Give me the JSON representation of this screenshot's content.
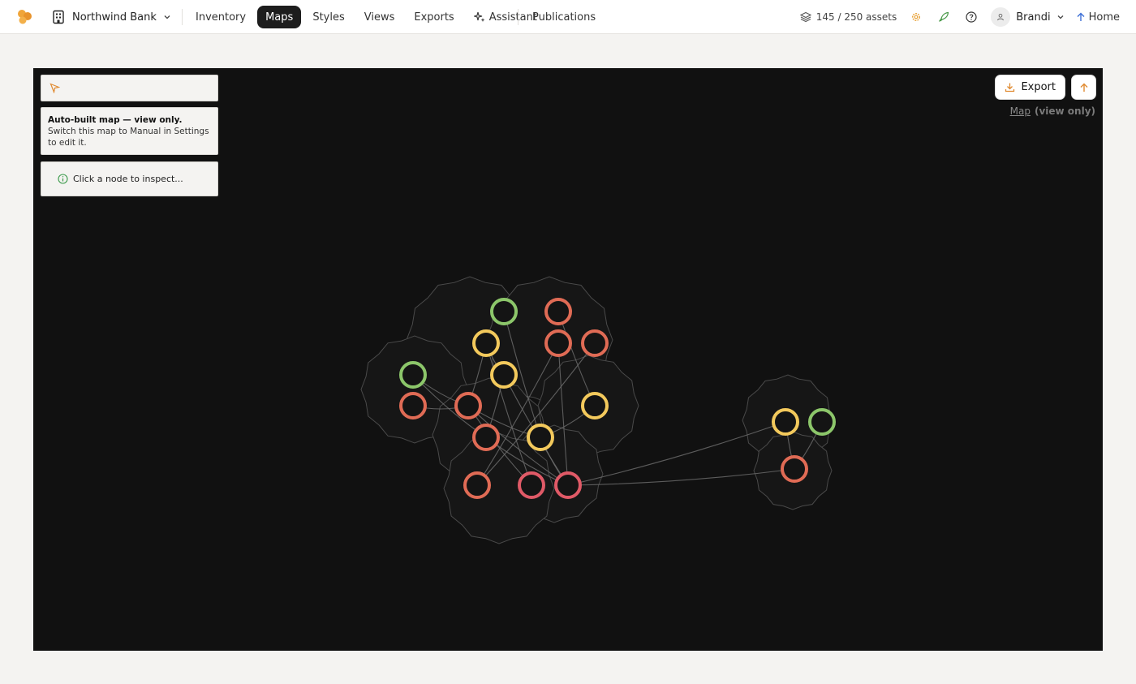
{
  "header": {
    "org_name": "Northwind Bank",
    "nav": [
      {
        "label": "Inventory",
        "active": false
      },
      {
        "label": "Maps",
        "active": true
      },
      {
        "label": "Styles",
        "active": false
      },
      {
        "label": "Views",
        "active": false
      },
      {
        "label": "Exports",
        "active": false
      },
      {
        "label": "Assistant",
        "active": false
      }
    ],
    "publications": "Publications",
    "assets": "145 / 250 assets",
    "user": "Brandi",
    "home": "Home"
  },
  "colors": {
    "accent": "#e8a33a",
    "green": "#8cc66a",
    "red": "#e06b55",
    "yellow": "#f3c95c",
    "pink": "#e05a67",
    "canvas": "#111111"
  },
  "map": {
    "search_placeholder": "",
    "notice_bold": "Auto-built map — view only.",
    "notice_text": " Switch this map to Manual in Settings to edit it.",
    "inspect_text": "Click a node to inspect...",
    "export_label": "Export",
    "view_link": "Map",
    "view_mode": "(view only)"
  }
}
